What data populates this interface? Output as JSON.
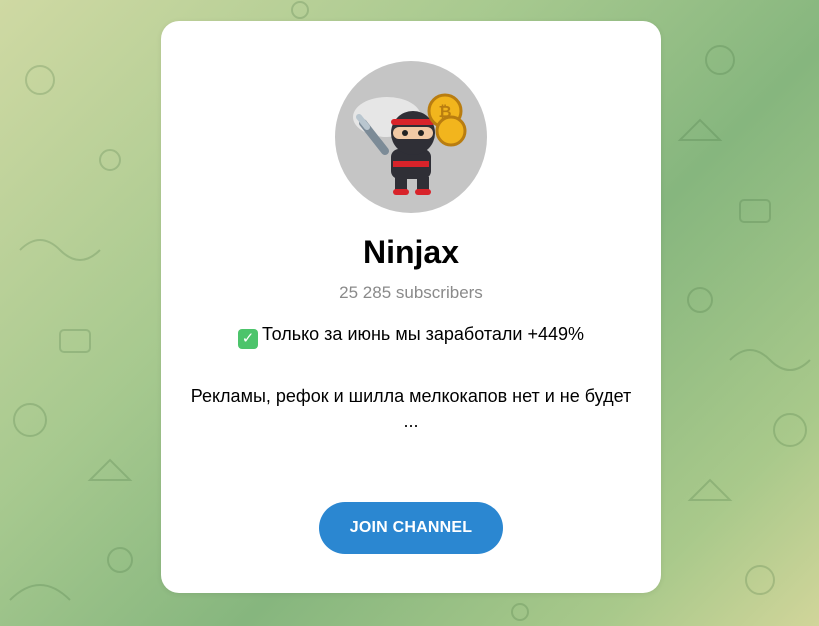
{
  "channel": {
    "name": "Ninjax",
    "subscribers": "25 285 subscribers",
    "avatar_icon": "ninja-avatar-icon"
  },
  "description": {
    "line1_icon": "check-mark-icon",
    "line1": "Только за июнь мы заработали +449%",
    "line2": "Рекламы, рефок и шилла мелкокапов нет и не будет",
    "ellipsis": "..."
  },
  "actions": {
    "join_label": "JOIN CHANNEL"
  },
  "colors": {
    "accent": "#2b87d1",
    "check_green": "#4cc46b",
    "background": "#a7c98f"
  }
}
